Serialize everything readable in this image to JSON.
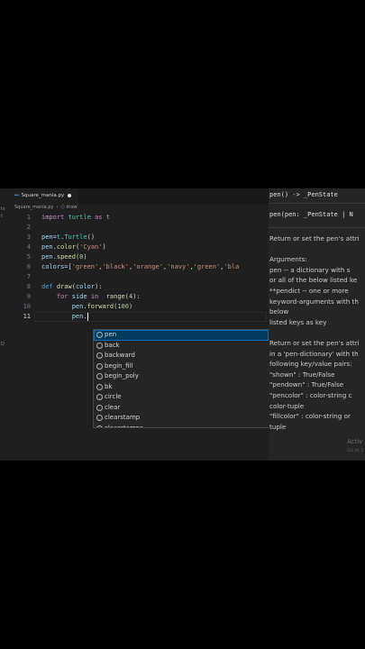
{
  "tab": {
    "filename": "Square_mania.py",
    "icon": "python-file-icon"
  },
  "breadcrumb": {
    "file": "Square_mania.py",
    "sep": "›",
    "symbol": "draw"
  },
  "left_gutter": [
    "ts",
    "t",
    "D"
  ],
  "code_lines": [
    {
      "n": "1",
      "text": "import turtle as t"
    },
    {
      "n": "2",
      "text": ""
    },
    {
      "n": "3",
      "text": "pen=t.Turtle()"
    },
    {
      "n": "4",
      "text": "pen.color('Cyan')"
    },
    {
      "n": "5",
      "text": "pen.speed(0)"
    },
    {
      "n": "6",
      "text": "colors=['green','black','orange','navy','green','bla"
    },
    {
      "n": "7",
      "text": ""
    },
    {
      "n": "8",
      "text": "def draw(color):"
    },
    {
      "n": "9",
      "text": "    for side in  range(4):"
    },
    {
      "n": "10",
      "text": "        pen.forward(100)"
    },
    {
      "n": "11",
      "text": "        pen."
    }
  ],
  "suggestions": [
    "pen",
    "back",
    "backward",
    "begin_fill",
    "begin_poly",
    "bk",
    "circle",
    "clear",
    "clearstamp",
    "clearstamps"
  ],
  "selected_suggestion": "pen",
  "hover": {
    "signature1": "pen() -> _PenState",
    "signature2": "pen(pen: _PenState | N",
    "doc": [
      "Return or set the pen's attri",
      "",
      "Arguments:",
      "  pen -- a dictionary with s",
      "or all of the below listed ke",
      "**pendict -- one or more",
      "keyword-arguments with th",
      "below",
      "          listed keys as key",
      "",
      "Return or set the pen's attri",
      "in a 'pen-dictionary' with th",
      "following key/value pairs:",
      "   \"shown\" : True/False",
      "   \"pendown\" : True/False",
      "   \"pencolor\" : color-string c",
      "color-tuple",
      "   \"fillcolor\" : color-string or",
      "tuple"
    ]
  },
  "watermark": {
    "line1": "Activ",
    "line2": "Go to S"
  }
}
